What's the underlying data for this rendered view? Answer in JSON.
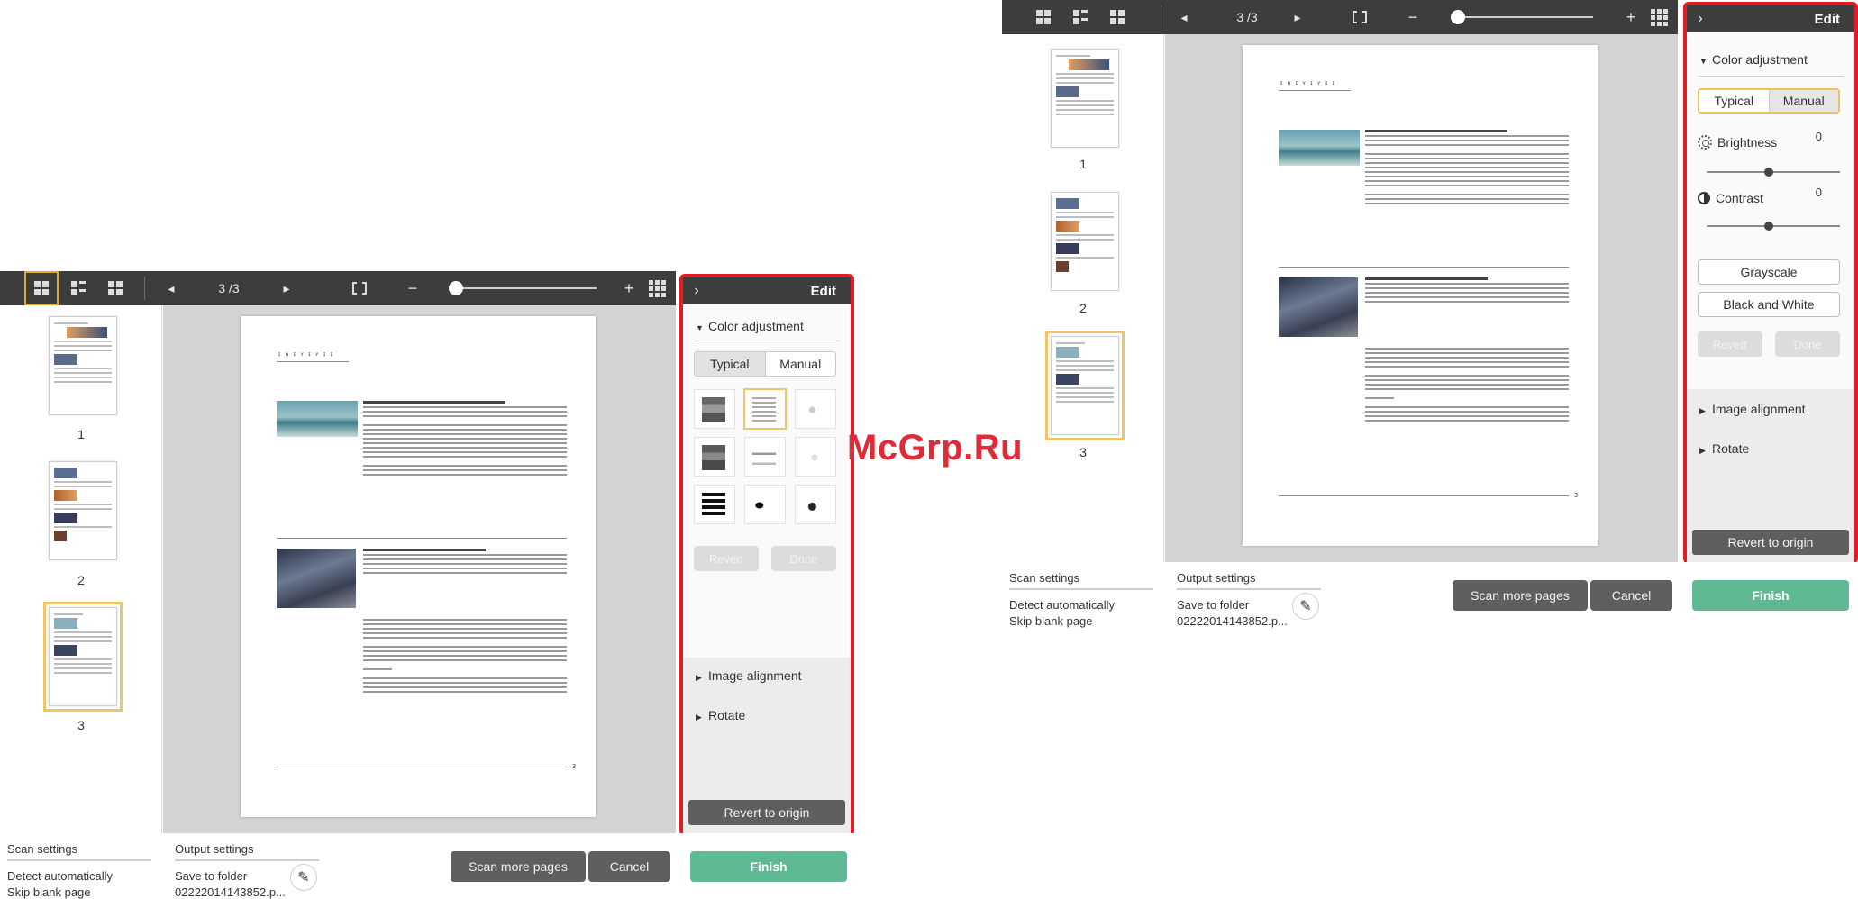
{
  "toolbar": {
    "page_indicator": "3 /3",
    "prev_icon": "triangle-left-icon",
    "next_icon": "triangle-right-icon",
    "zoom_out": "−",
    "zoom_in": "+"
  },
  "thumbnails": [
    {
      "number": "1"
    },
    {
      "number": "2"
    },
    {
      "number": "3"
    }
  ],
  "page": {
    "header_text": "ɪ ɴ ɪ ʏ ɪ ʏ ɪ ɪ",
    "page_number": "3"
  },
  "edit_panel": {
    "title": "Edit",
    "collapse_icon": "chevron-right-icon",
    "color_adjustment": "Color adjustment",
    "mode_typical": "Typical",
    "mode_manual": "Manual",
    "brightness_label": "Brightness",
    "brightness_value": "0",
    "contrast_label": "Contrast",
    "contrast_value": "0",
    "grayscale": "Grayscale",
    "black_and_white": "Black and White",
    "revert": "Revert",
    "done": "Done",
    "image_alignment": "Image alignment",
    "rotate": "Rotate",
    "revert_to_origin": "Revert to origin"
  },
  "bottom": {
    "scan_settings_title": "Scan settings",
    "scan_settings_line1": "Detect automatically",
    "scan_settings_line2": "Skip blank page",
    "output_settings_title": "Output settings",
    "output_settings_line1": "Save to folder",
    "output_settings_line2": "02222014143852.p...",
    "scan_more_pages": "Scan more pages",
    "cancel": "Cancel",
    "finish": "Finish"
  },
  "watermark": "McGrp.Ru",
  "colors": {
    "toolbar": "#3d3d3d",
    "highlight": "#e31b23",
    "selection": "#f1c566",
    "finish": "#5fba94",
    "dark_button": "#5f5f5f"
  }
}
